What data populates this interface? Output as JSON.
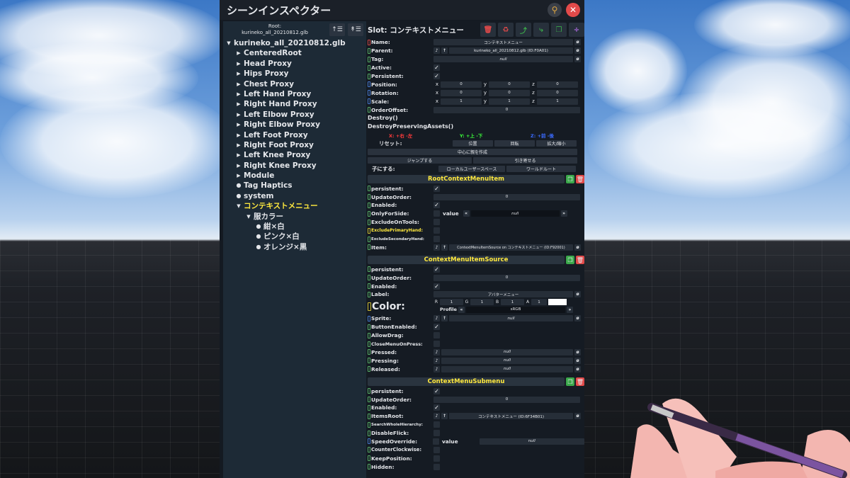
{
  "window": {
    "title": "シーンインスペクター"
  },
  "tree": {
    "root_label": "Root:",
    "root_value": "kurineko_all_20210812.glb",
    "nodes": [
      {
        "label": "kurineko_all_20210812.glb",
        "depth": 0,
        "kind": "expanded"
      },
      {
        "label": "CenteredRoot",
        "depth": 1,
        "kind": "collapsed"
      },
      {
        "label": "Head Proxy",
        "depth": 1,
        "kind": "collapsed"
      },
      {
        "label": "Hips Proxy",
        "depth": 1,
        "kind": "collapsed"
      },
      {
        "label": "Chest Proxy",
        "depth": 1,
        "kind": "collapsed"
      },
      {
        "label": "Left Hand Proxy",
        "depth": 1,
        "kind": "collapsed"
      },
      {
        "label": "Right Hand Proxy",
        "depth": 1,
        "kind": "collapsed"
      },
      {
        "label": "Left Elbow Proxy",
        "depth": 1,
        "kind": "collapsed"
      },
      {
        "label": "Right Elbow Proxy",
        "depth": 1,
        "kind": "collapsed"
      },
      {
        "label": "Left Foot Proxy",
        "depth": 1,
        "kind": "collapsed"
      },
      {
        "label": "Right Foot Proxy",
        "depth": 1,
        "kind": "collapsed"
      },
      {
        "label": "Left Knee Proxy",
        "depth": 1,
        "kind": "collapsed"
      },
      {
        "label": "Right Knee Proxy",
        "depth": 1,
        "kind": "collapsed"
      },
      {
        "label": "Module",
        "depth": 1,
        "kind": "collapsed"
      },
      {
        "label": "Tag Haptics",
        "depth": 1,
        "kind": "leaf"
      },
      {
        "label": "system",
        "depth": 1,
        "kind": "leaf"
      },
      {
        "label": "コンテキストメニュー",
        "depth": 1,
        "kind": "expanded",
        "selected": true
      },
      {
        "label": "服カラー",
        "depth": 2,
        "kind": "expanded"
      },
      {
        "label": "紺×白",
        "depth": 3,
        "kind": "leaf"
      },
      {
        "label": "ピンク×白",
        "depth": 3,
        "kind": "leaf"
      },
      {
        "label": "オレンジ×黒",
        "depth": 3,
        "kind": "leaf"
      }
    ]
  },
  "slot": {
    "header": "Slot: コンテキストメニュー",
    "name_label": "Name:",
    "name_value": "コンテキストメニュー",
    "parent_label": "Parent:",
    "parent_value": "kurineko_all_20210812.glb (ID:F0A01)",
    "tag_label": "Tag:",
    "tag_value": "null",
    "active_label": "Active:",
    "persistent_label": "Persistent:",
    "position_label": "Position:",
    "position": [
      "0",
      "0",
      "0"
    ],
    "rotation_label": "Rotation:",
    "rotation": [
      "0",
      "0",
      "0"
    ],
    "scale_label": "Scale:",
    "scale": [
      "1",
      "1",
      "1"
    ],
    "order_label": "OrderOffset:",
    "order_value": "0",
    "axis_x": "x",
    "axis_y": "y",
    "axis_z": "z",
    "destroy": "Destroy()",
    "destroy_preserving": "DestroyPreservingAssets()",
    "dir_x": "X: +右 -左",
    "dir_y": "Y: +上 -下",
    "dir_z": "Z: +前 -後",
    "reset_label": "リセット:",
    "reset_position": "位置",
    "reset_rotation": "回転",
    "reset_scale": "拡大/縮小",
    "create_parent": "中心に親を作成",
    "jump": "ジャンプする",
    "pull": "引き寄せる",
    "child_label": "子にする:",
    "local_user_space": "ローカルユーザースペース",
    "world_root": "ワールドルート"
  },
  "components": {
    "c1": {
      "title": "RootContextMenuItem",
      "persistent": "persistent:",
      "update_order": "UpdateOrder:",
      "update_order_value": "0",
      "enabled": "Enabled:",
      "only_for_side": "OnlyForSide:",
      "value_label": "value",
      "only_for_side_value": "null",
      "exclude_on_tools": "ExcludeOnTools:",
      "exclude_primary": "ExcludePrimaryHand:",
      "exclude_secondary": "ExcludeSecondaryHand:",
      "item": "Item:",
      "item_value": "ContextMenuItemSource on コンテキストメニュー (ID:F92001)"
    },
    "c2": {
      "title": "ContextMenuItemSource",
      "persistent": "persistent:",
      "update_order": "UpdateOrder:",
      "update_order_value": "0",
      "enabled": "Enabled:",
      "label": "Label:",
      "label_value": "アバターメニュー",
      "color": "Color:",
      "r": "R",
      "r_val": "1",
      "g": "G",
      "g_val": "1",
      "b": "B",
      "b_val": "1",
      "a": "A",
      "a_val": "1",
      "profile": "Profile",
      "profile_value": "sRGB",
      "sprite": "Sprite:",
      "sprite_value": "null",
      "button_enabled": "ButtonEnabled:",
      "allow_drag": "AllowDrag:",
      "close_on_press": "CloseMenuOnPress:",
      "pressed": "Pressed:",
      "pressing": "Pressing:",
      "released": "Released:",
      "null": "null"
    },
    "c3": {
      "title": "ContextMenuSubmenu",
      "persistent": "persistent:",
      "update_order": "UpdateOrder:",
      "update_order_value": "0",
      "enabled": "Enabled:",
      "items_root": "ItemsRoot:",
      "items_root_value": "コンテキストメニュー (ID:6F34B01)",
      "search_whole": "SearchWholeHierarchy:",
      "disable_flick": "DisableFlick:",
      "speed_override": "SpeedOverride:",
      "value_label": "value",
      "speed_value": "null",
      "counter_clockwise": "CounterClockwise:",
      "keep_position": "KeepPosition:",
      "hidden": "Hidden:"
    }
  },
  "colors": {
    "accent": "#ffe93e",
    "x": "#ff3b3b",
    "y": "#3bff3b",
    "z": "#3b6bff",
    "delete": "#e24a4a",
    "duplicate": "#3aa84a"
  }
}
